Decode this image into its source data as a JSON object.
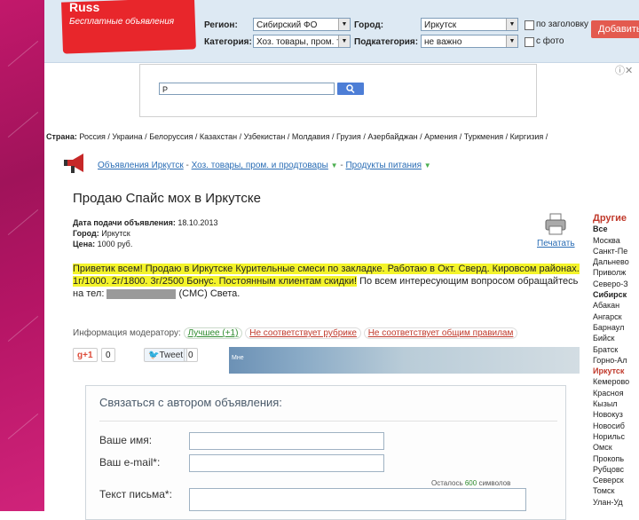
{
  "header": {
    "logo_text": "Russ",
    "logo_sub": "Бесплатные объявления",
    "region_label": "Регион:",
    "region_value": "Сибирский ФО",
    "city_label": "Город:",
    "city_value": "Иркутск",
    "category_label": "Категория:",
    "category_value": "Хоз. товары, пром. т",
    "subcategory_label": "Подкатегория:",
    "subcategory_value": "не важно",
    "titles_only_label": "по заголовку",
    "with_photo_label": "с фото",
    "add_button": "Добавить"
  },
  "ad": {
    "search_value": "Р"
  },
  "countries": {
    "lead": "Страна:",
    "items": [
      "Россия",
      "Украина",
      "Белоруссия",
      "Казахстан",
      "Узбекистан",
      "Молдавия",
      "Грузия",
      "Азербайджан",
      "Армения",
      "Туркмения",
      "Киргизия"
    ]
  },
  "breadcrumb": {
    "items": [
      "Объявления Иркутск",
      "Хоз. товары, пром. и продтовары",
      "Продукты питания"
    ]
  },
  "listing": {
    "title": "Продаю Спайс мох в Иркутске",
    "date_label": "Дата подачи объявления:",
    "date_value": "18.10.2013",
    "city_label": "Город:",
    "city_value": "Иркутск",
    "price_label": "Цена:",
    "price_value": "1000 руб.",
    "print_label": "Печатать",
    "desc_highlight": "Приветик всем! Продаю в Иркутске Курительные смеси по закладке. Работаю в Окт. Сверд. Кировсом районах. 1г/1000. 2г/1800. 3г/2500 Бонус. Постоянным клиентам скидки!",
    "desc_rest": " По всем интересующим вопросом обращайтесь на тел:",
    "desc_tail": "(СМС) Света."
  },
  "moderator": {
    "label": "Информация модератору:",
    "good": "Лучшее (+1)",
    "wrong_category": "Не соответствует рубрике",
    "wrong_rules": "Не соответствует общим правилам"
  },
  "social": {
    "gplus": "g+1",
    "gplus_count": "0",
    "tweet": "Tweet",
    "tweet_count": "0",
    "strip_label": "Мне"
  },
  "contact": {
    "title": "Связаться с автором объявления:",
    "name_label": "Ваше имя:",
    "email_label": "Ваш e-mail*:",
    "message_label": "Текст письма*:",
    "chars_left_prefix": "Осталось",
    "chars_left_count": "600",
    "chars_left_suffix": "символов"
  },
  "sidebar": {
    "title": "Другие",
    "items": [
      {
        "label": "Все",
        "style": "b"
      },
      {
        "label": "Москва",
        "style": ""
      },
      {
        "label": "Санкт-Пе",
        "style": ""
      },
      {
        "label": "Дальнево",
        "style": ""
      },
      {
        "label": "Приволж",
        "style": ""
      },
      {
        "label": "Северо-З",
        "style": ""
      },
      {
        "label": "Сибирск",
        "style": "b"
      },
      {
        "label": "Абакан",
        "style": "bul"
      },
      {
        "label": "Ангарск",
        "style": "bul"
      },
      {
        "label": "Барнаул",
        "style": "bul"
      },
      {
        "label": "Бийск",
        "style": "bul"
      },
      {
        "label": "Братск",
        "style": "bul"
      },
      {
        "label": "Горно-Ал",
        "style": "bul"
      },
      {
        "label": "Иркутск",
        "style": "bul red"
      },
      {
        "label": "Кемерово",
        "style": "bul"
      },
      {
        "label": "Красноя",
        "style": "bul"
      },
      {
        "label": "Кызыл",
        "style": "bul"
      },
      {
        "label": "Новокуз",
        "style": "bul"
      },
      {
        "label": "Новосиб",
        "style": "bul"
      },
      {
        "label": "Норильс",
        "style": "bul"
      },
      {
        "label": "Омск",
        "style": "bul"
      },
      {
        "label": "Прокопь",
        "style": "bul"
      },
      {
        "label": "Рубцовс",
        "style": "bul"
      },
      {
        "label": "Северск",
        "style": "bul"
      },
      {
        "label": "Томск",
        "style": "bul"
      },
      {
        "label": "Улан-Уд",
        "style": "bul"
      }
    ]
  },
  "colors": {
    "accent_red": "#e8262b",
    "link_blue": "#2a6db5",
    "highlight_yellow": "#f4f42a",
    "strip_pink": "#c2186b"
  }
}
